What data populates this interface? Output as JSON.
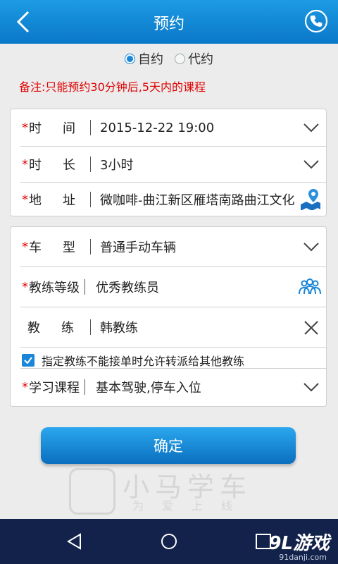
{
  "header": {
    "title": "预约",
    "back_icon": "chevron-left-icon",
    "phone_icon": "phone-icon"
  },
  "booking_type": {
    "options": [
      "自约",
      "代约"
    ],
    "selected": "自约"
  },
  "note": "备注:只能预约30分钟后,5天内的课程",
  "form1": {
    "time": {
      "label_a": "时",
      "label_b": "间",
      "value": "2015-12-22 19:00"
    },
    "duration": {
      "label_a": "时",
      "label_b": "长",
      "value": "3小时"
    },
    "address": {
      "label_a": "地",
      "label_b": "址",
      "value": "微咖啡-曲江新区雁塔南路曲江文化"
    }
  },
  "form2": {
    "car_type": {
      "label_a": "车",
      "label_b": "型",
      "value": "普通手动车辆"
    },
    "coach_level": {
      "label": "教练等级",
      "value": "优秀教练员"
    },
    "coach": {
      "label_a": "教",
      "label_b": "练",
      "value": "韩教练"
    },
    "transfer_checkbox": {
      "label": "指定教练不能接单时允许转派给其他教练",
      "checked": true
    },
    "course": {
      "label": "学习课程",
      "value": "基本驾驶,停车入位"
    }
  },
  "required_mark": "*",
  "confirm_label": "确定",
  "watermark": {
    "title": "小马学车",
    "subtitle": "为爱上线"
  },
  "brand": {
    "name": "9L游戏",
    "domain": "91danji.com"
  },
  "colors": {
    "primary": "#0a77c8",
    "required": "#e00000",
    "navbar": "#13224a"
  }
}
